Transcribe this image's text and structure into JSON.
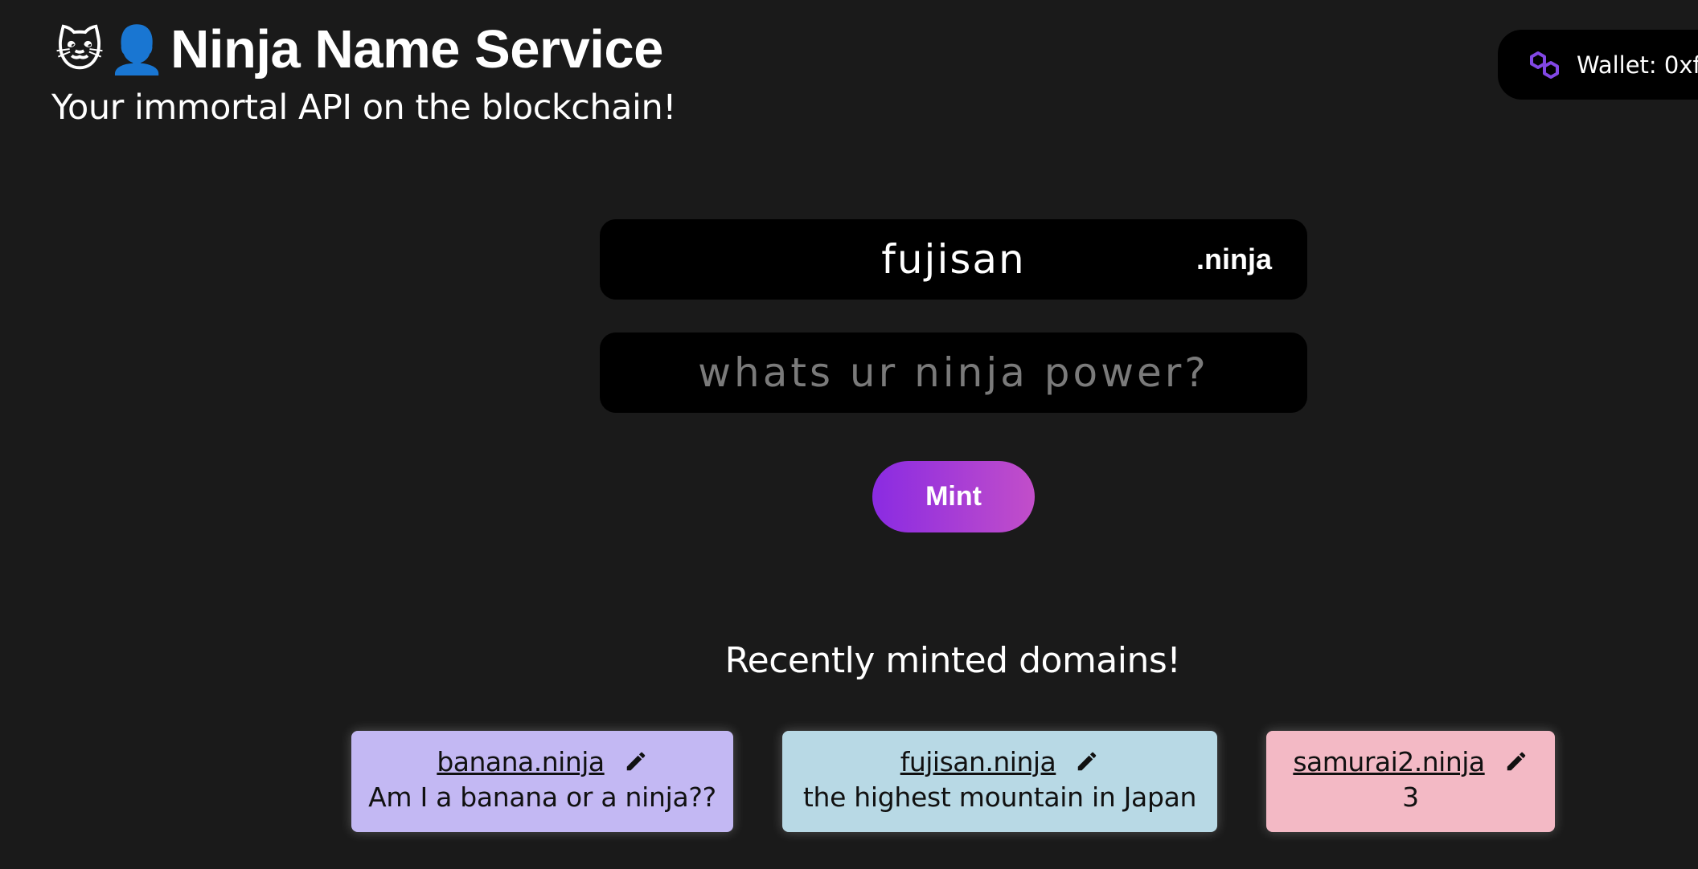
{
  "header": {
    "emoji_cat": "🐱",
    "emoji_person": "👤",
    "title": "Ninja Name Service",
    "subtitle": "Your immortal API on the blockchain!"
  },
  "wallet": {
    "icon": "polygon-icon",
    "label": "Wallet: 0xf",
    "icon_color": "#8247e5"
  },
  "form": {
    "domain_value": "fujisan",
    "tld": ".ninja",
    "record_placeholder": "whats ur ninja power?",
    "record_value": "",
    "mint_label": "Mint"
  },
  "recent": {
    "title": "Recently minted domains!",
    "domains": [
      {
        "name": "banana.ninja",
        "record": "Am I a banana or a ninja??",
        "color": "#c3b8f3",
        "edit_icon": "pencil-icon"
      },
      {
        "name": "fujisan.ninja",
        "record": "the highest mountain in Japan",
        "color": "#b8d9e5",
        "edit_icon": "pencil-icon"
      },
      {
        "name": "samurai2.ninja",
        "record": "3",
        "color": "#f3b9c5",
        "edit_icon": "pencil-icon"
      }
    ]
  },
  "colors": {
    "background": "#1a1a1a",
    "field_background": "#000000",
    "mint_gradient_start": "#8a2be2",
    "mint_gradient_end": "#c24ec9"
  }
}
